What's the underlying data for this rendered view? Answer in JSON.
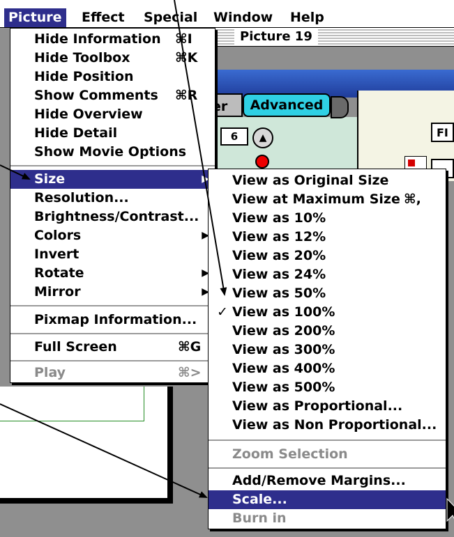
{
  "menubar": {
    "items": [
      "Picture",
      "Effect",
      "Special",
      "Window",
      "Help"
    ]
  },
  "window": {
    "title": "Picture 19",
    "button_partial": "er",
    "button_advanced": "Advanced",
    "field_fi": "FI",
    "counter": "6"
  },
  "picture_menu": {
    "items": [
      {
        "label": "Hide Information",
        "shortcut": "⌘I"
      },
      {
        "label": "Hide Toolbox",
        "shortcut": "⌘K"
      },
      {
        "label": "Hide Position",
        "shortcut": ""
      },
      {
        "label": "Show Comments",
        "shortcut": "⌘R"
      },
      {
        "label": "Hide Overview",
        "shortcut": ""
      },
      {
        "label": "Hide Detail",
        "shortcut": ""
      },
      {
        "label": "Show Movie Options",
        "shortcut": ""
      },
      {
        "label": "Size",
        "shortcut": ""
      },
      {
        "label": "Resolution...",
        "shortcut": ""
      },
      {
        "label": "Brightness/Contrast...",
        "shortcut": ""
      },
      {
        "label": "Colors",
        "shortcut": ""
      },
      {
        "label": "Invert",
        "shortcut": ""
      },
      {
        "label": "Rotate",
        "shortcut": ""
      },
      {
        "label": "Mirror",
        "shortcut": ""
      },
      {
        "label": "Pixmap Information...",
        "shortcut": ""
      },
      {
        "label": "Full Screen",
        "shortcut": "⌘G"
      },
      {
        "label": "Play",
        "shortcut": "⌘>"
      }
    ]
  },
  "size_menu": {
    "items": [
      {
        "label": "View as Original Size",
        "shortcut": ""
      },
      {
        "label": "View at Maximum Size",
        "shortcut": "⌘,"
      },
      {
        "label": "View as 10%"
      },
      {
        "label": "View as 12%"
      },
      {
        "label": "View as 20%"
      },
      {
        "label": "View as 24%"
      },
      {
        "label": "View as 50%"
      },
      {
        "label": "View as 100%",
        "checked": true
      },
      {
        "label": "View as 200%"
      },
      {
        "label": "View as 300%"
      },
      {
        "label": "View as 400%"
      },
      {
        "label": "View as 500%"
      },
      {
        "label": "View as Proportional..."
      },
      {
        "label": "View as Non Proportional..."
      },
      {
        "label": "Zoom Selection"
      },
      {
        "label": "Add/Remove Margins..."
      },
      {
        "label": "Scale..."
      },
      {
        "label": "Burn in"
      }
    ]
  },
  "colors": {
    "highlight": "#2e2e8c",
    "disabled": "#8a8a8a",
    "advanced_button": "#2fd0e4"
  },
  "icons": [
    "checkmark-icon",
    "submenu-triangle-icon",
    "command-key-icon",
    "mouse-pointer-icon"
  ]
}
